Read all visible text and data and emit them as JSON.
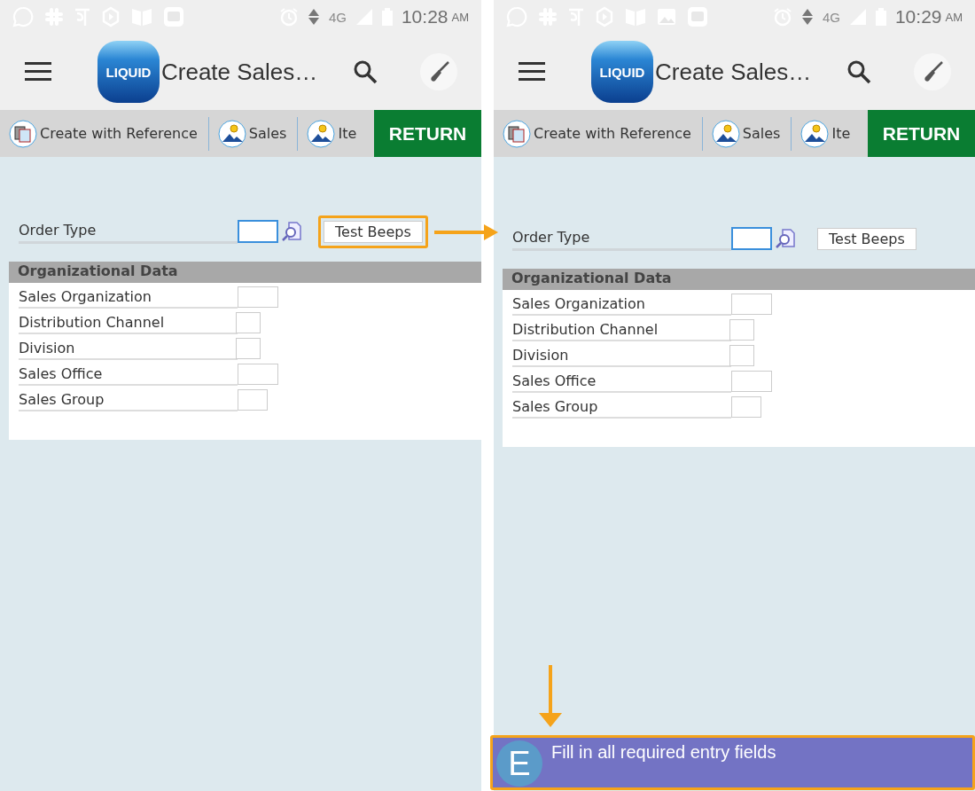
{
  "screens": [
    {
      "status_bar": {
        "left_icons": [
          {
            "kind": "chat"
          },
          {
            "kind": "hash"
          },
          {
            "kind": "glyph"
          },
          {
            "kind": "hexagon"
          },
          {
            "kind": "book"
          },
          {
            "kind": "square-app"
          }
        ],
        "network": "4G",
        "time": "10:28",
        "ampm": "AM"
      },
      "app_bar": {
        "logo": "LIQUID",
        "title": "Create Sales…"
      },
      "toolbar": {
        "items": [
          {
            "kind": "copy",
            "label": "Create with Reference"
          },
          {
            "kind": "picture",
            "label": "Sales"
          },
          {
            "kind": "picture",
            "label": "Ite"
          }
        ],
        "return_button": "RETURN"
      },
      "order_type": {
        "label": "Order Type",
        "button": "Test Beeps",
        "highlighted": true
      },
      "section": {
        "title": "Organizational Data",
        "fields": [
          "Sales Organization",
          "Distribution Channel",
          "Division",
          "Sales Office",
          "Sales Group"
        ]
      }
    },
    {
      "status_bar": {
        "left_icons": [
          {
            "kind": "chat"
          },
          {
            "kind": "hash"
          },
          {
            "kind": "glyph"
          },
          {
            "kind": "hexagon"
          },
          {
            "kind": "book"
          },
          {
            "kind": "image"
          },
          {
            "kind": "square-app"
          }
        ],
        "network": "4G",
        "time": "10:29",
        "ampm": "AM"
      },
      "app_bar": {
        "logo": "LIQUID",
        "title": "Create Sales…"
      },
      "toolbar": {
        "items": [
          {
            "kind": "copy",
            "label": "Create with Reference"
          },
          {
            "kind": "picture",
            "label": "Sales"
          },
          {
            "kind": "picture",
            "label": "Ite"
          }
        ],
        "return_button": "RETURN"
      },
      "order_type": {
        "label": "Order Type",
        "button": "Test Beeps",
        "highlighted": false
      },
      "section": {
        "title": "Organizational Data",
        "fields": [
          "Sales Organization",
          "Distribution Channel",
          "Division",
          "Sales Office",
          "Sales Group"
        ]
      },
      "message": {
        "badge": "E",
        "text": "Fill in all required entry fields",
        "highlighted": true
      }
    }
  ],
  "annotations": [
    {
      "kind": "right-arrow"
    },
    {
      "kind": "down-arrow"
    }
  ]
}
